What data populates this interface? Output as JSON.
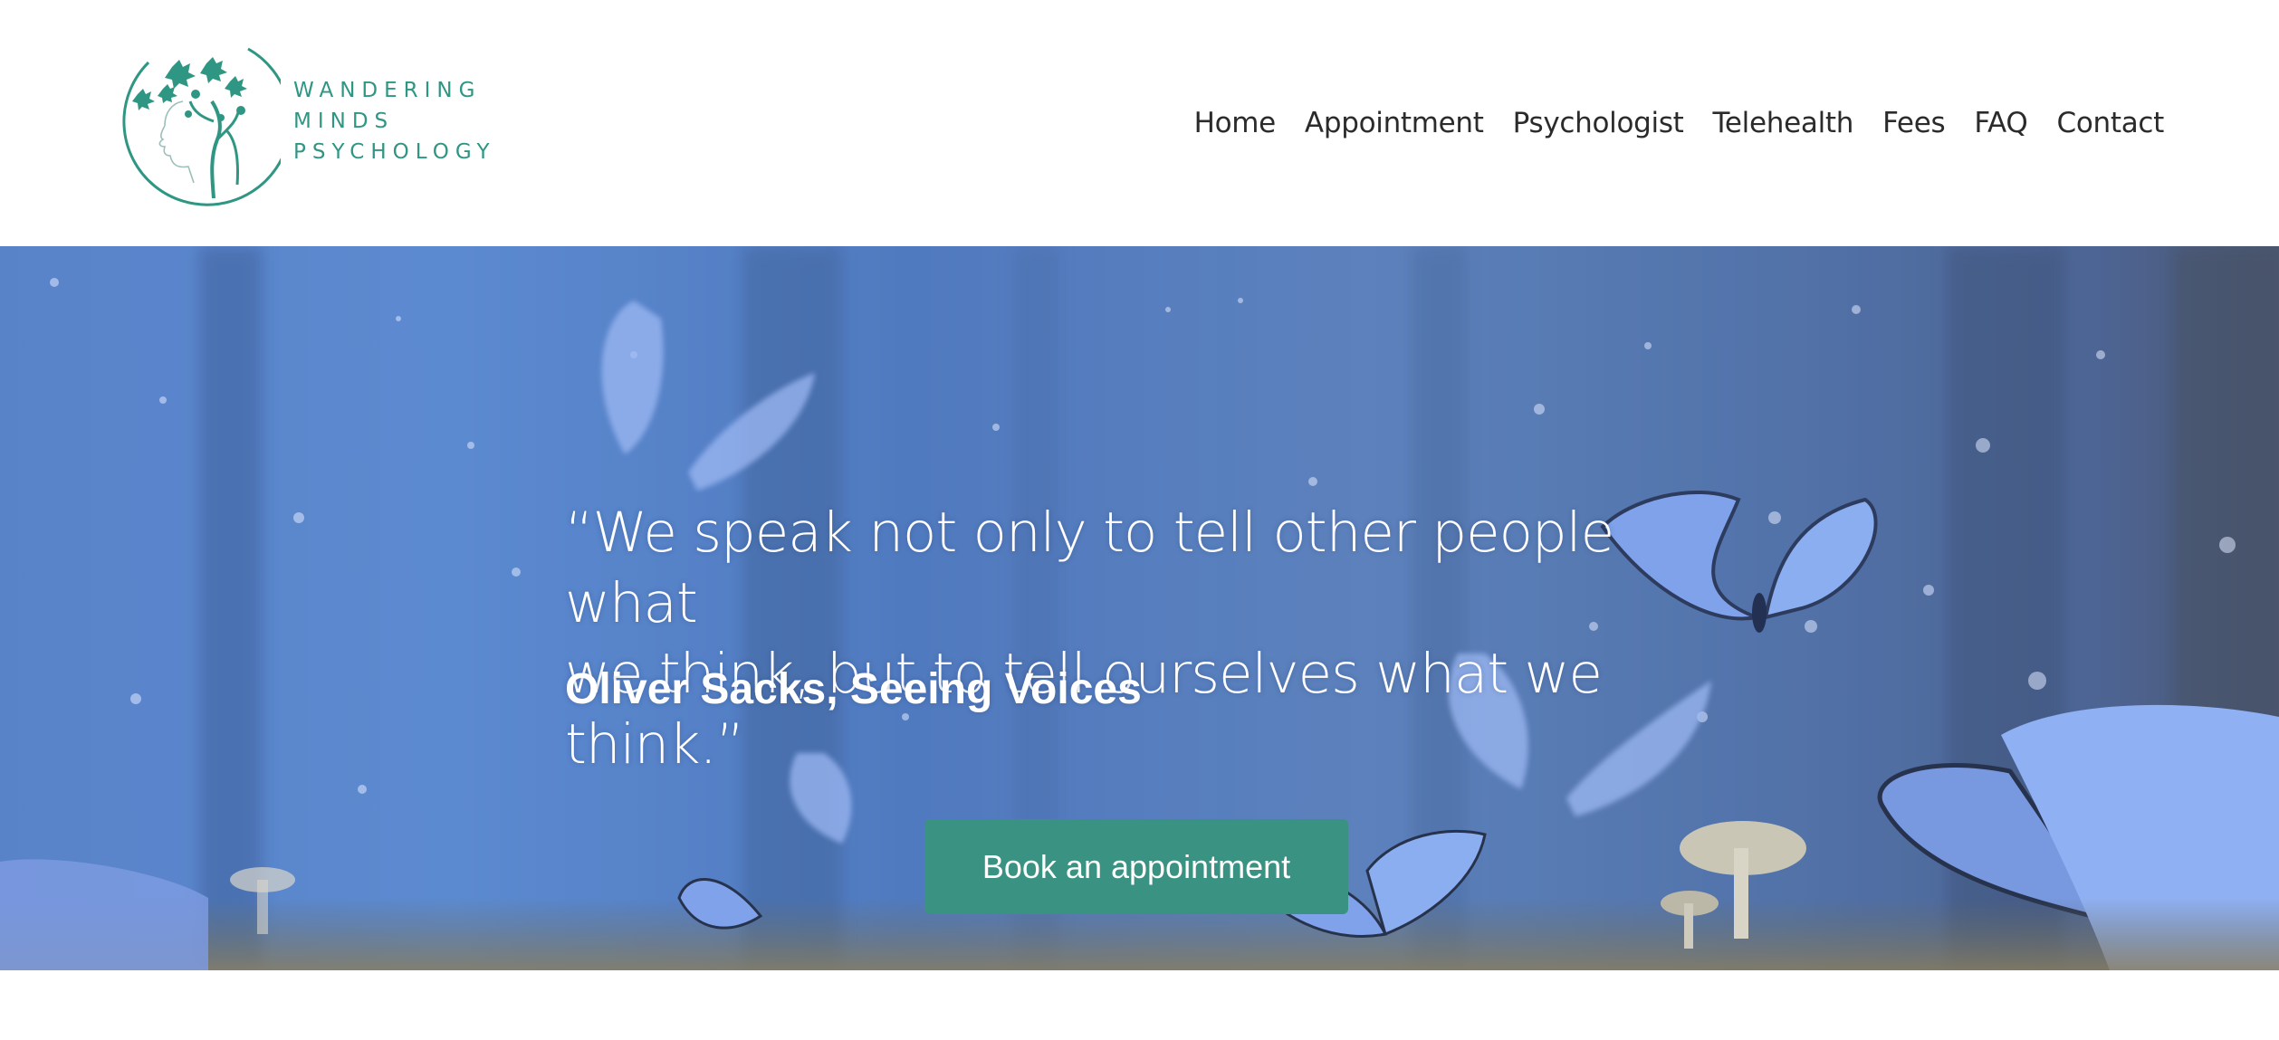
{
  "brand": {
    "lines": [
      "WANDERING",
      "MINDS",
      "PSYCHOLOGY"
    ],
    "color": "#2f9683"
  },
  "nav": {
    "items": [
      {
        "label": "Home"
      },
      {
        "label": "Appointment"
      },
      {
        "label": "Psychologist"
      },
      {
        "label": "Telehealth"
      },
      {
        "label": "Fees"
      },
      {
        "label": "FAQ"
      },
      {
        "label": "Contact"
      }
    ]
  },
  "hero": {
    "quote_line1": "“We speak not only to tell other people what",
    "quote_line2": "we think, but to tell ourselves what we think.”",
    "author": "Oliver Sacks, Seeing Voices",
    "cta_label": "Book an appointment",
    "cta_color": "#3a9282"
  },
  "icons": [
    "brain-tree-logo-icon"
  ]
}
